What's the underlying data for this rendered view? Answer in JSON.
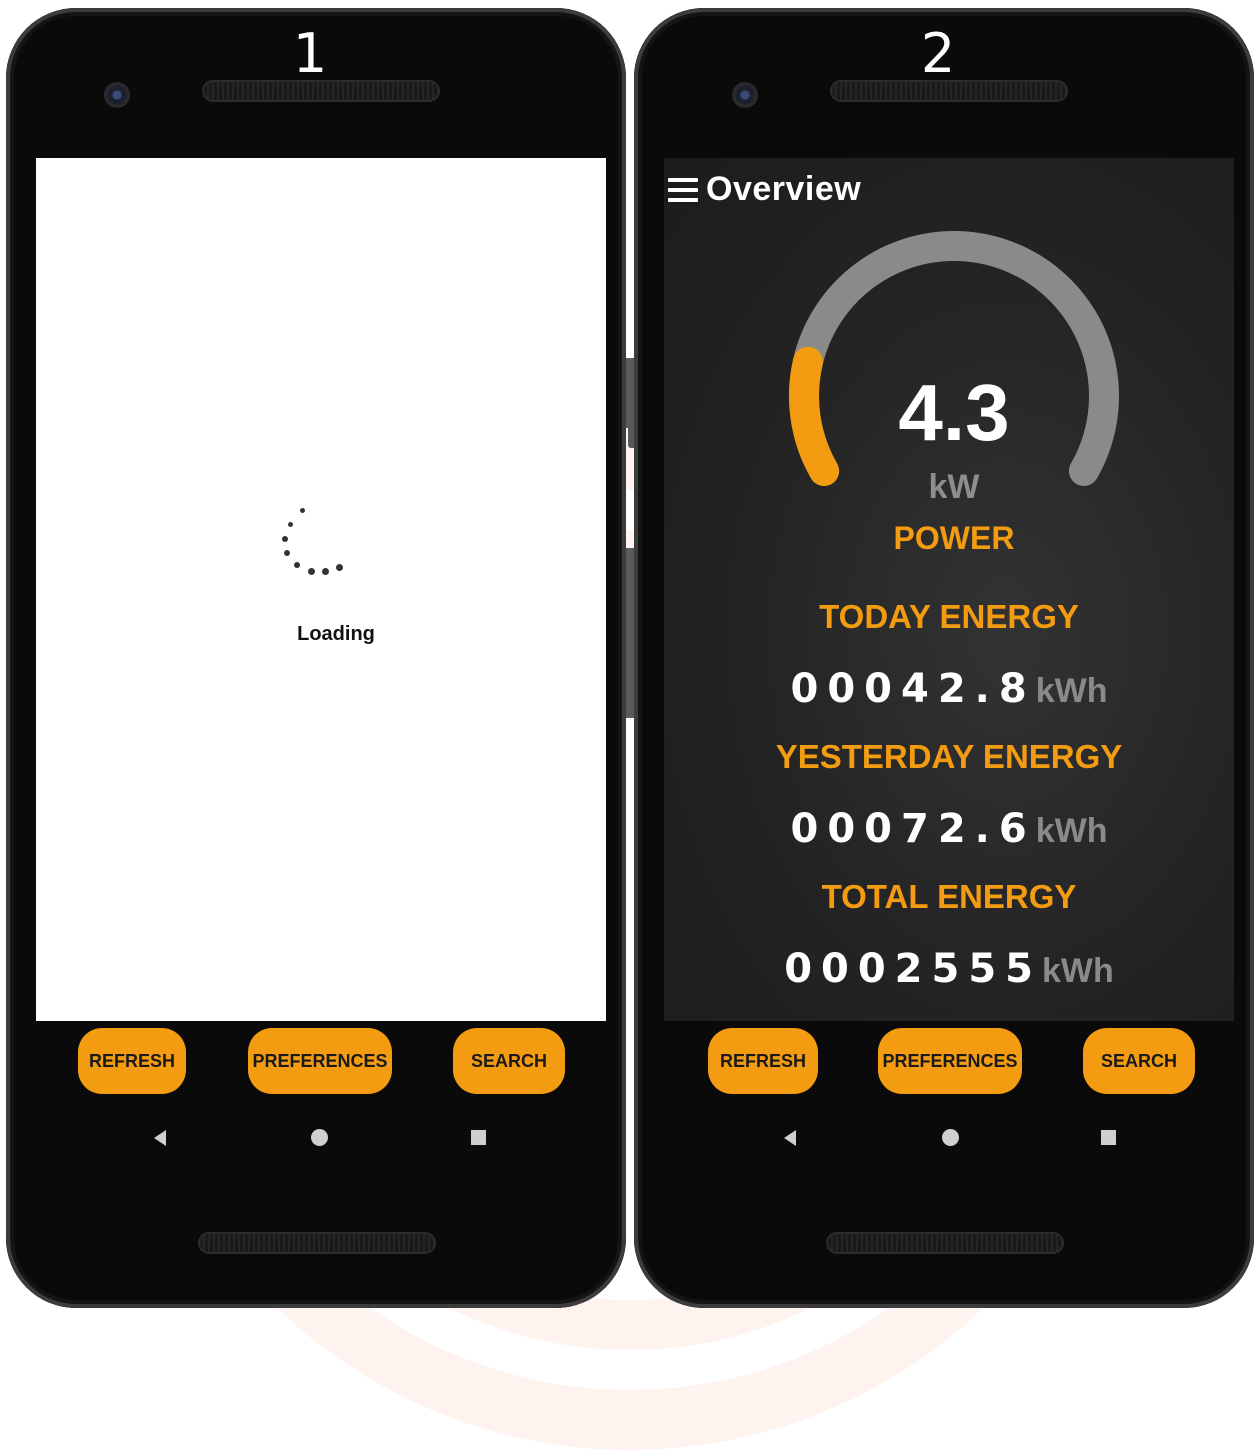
{
  "phone1": {
    "number": "1",
    "loading_text": "Loading",
    "buttons": {
      "refresh": "REFRESH",
      "preferences": "PREFERENCES",
      "search": "SEARCH"
    }
  },
  "phone2": {
    "number": "2",
    "title": "Overview",
    "power": {
      "value": "4.3",
      "unit": "kW",
      "label": "POWER",
      "gauge_fill_fraction": 0.18
    },
    "today": {
      "label": "TODAY ENERGY",
      "value": "00042.8",
      "unit": "kWh"
    },
    "yesterday": {
      "label": "YESTERDAY ENERGY",
      "value": "00072.6",
      "unit": "kWh"
    },
    "total": {
      "label": "TOTAL ENERGY",
      "value": "0002555",
      "unit": "kWh"
    },
    "buttons": {
      "refresh": "REFRESH",
      "preferences": "PREFERENCES",
      "search": "SEARCH"
    }
  },
  "colors": {
    "accent": "#f39c12",
    "gauge_track": "#8a8a8a",
    "screen_dark": "#262626"
  },
  "icons": [
    "menu-icon",
    "spinner-icon",
    "back-icon",
    "home-icon",
    "recents-icon",
    "camera-icon"
  ]
}
